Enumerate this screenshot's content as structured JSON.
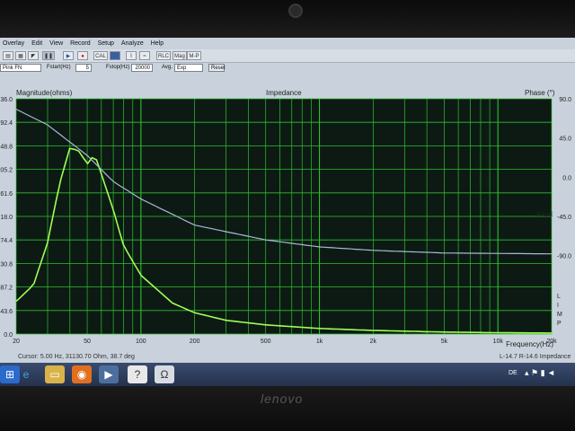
{
  "menu": [
    "Overlay",
    "Edit",
    "View",
    "Record",
    "Setup",
    "Analyze",
    "Help"
  ],
  "toolbar": {
    "buttons": [
      "CAL",
      "RLC",
      "Mag",
      "M-P"
    ]
  },
  "controls": {
    "signal": "Pink FN",
    "fstart_label": "Fstart(Hz)",
    "fstart_value": "5",
    "fstop_label": "Fstop(Hz)",
    "fstop_value": "20000",
    "avg_label": "Avg.",
    "avg_value": "Exp",
    "reset_label": "Reset"
  },
  "plot": {
    "left_axis_title": "Magnitude(ohms)",
    "center_title": "Impedance",
    "right_axis_title": "Phase (°)",
    "avg_label": "Avg.E",
    "limp_label": "LIMP",
    "x_axis_title": "Frequency(Hz)",
    "left_ticks": [
      "36.0",
      "92.4",
      "48.8",
      "05.2",
      "61.6",
      "18.0",
      "74.4",
      "30.8",
      "87.2",
      "43.6",
      "0.0"
    ],
    "right_ticks": [
      "90.0",
      "45.0",
      "0.0",
      "-45.0",
      "-90.0"
    ],
    "x_ticks": [
      "20",
      "50",
      "100",
      "200",
      "500",
      "1k",
      "2k",
      "5k",
      "10k",
      "20k"
    ]
  },
  "status": {
    "cursor_text": "Cursor: 5.00 Hz, 31130.70 Ohm, 38.7 deg",
    "right_text": "L-14.7  R-14.6  Impedance"
  },
  "taskbar": {
    "lang": "DE"
  },
  "bezel": {
    "brand": "lenovo"
  },
  "colors": {
    "plot_bg": "#0d1a14",
    "grid": "#2fbf2f",
    "magnitude": "#9dff55",
    "phase": "#a9b8d6"
  },
  "chart_data": {
    "type": "line",
    "title": "Impedance",
    "xlabel": "Frequency(Hz)",
    "ylabel": "Magnitude(ohms)",
    "y2label": "Phase (°)",
    "x_scale": "log",
    "xlim": [
      20,
      20000
    ],
    "series": [
      {
        "name": "Magnitude",
        "x": [
          20,
          25,
          30,
          35,
          40,
          45,
          50,
          55,
          60,
          70,
          80,
          100,
          150,
          200,
          300,
          500,
          1000,
          2000,
          5000,
          10000,
          20000
        ],
        "y": [
          10,
          15,
          28,
          46,
          57,
          56,
          52,
          55,
          49,
          38,
          27,
          18,
          9.5,
          6.5,
          4.2,
          2.8,
          1.7,
          1.1,
          0.6,
          0.4,
          0.3
        ]
      },
      {
        "name": "Phase",
        "x": [
          20,
          30,
          50,
          70,
          100,
          200,
          500,
          1000,
          2000,
          5000,
          20000
        ],
        "y": [
          78,
          60,
          25,
          -5,
          -25,
          -55,
          -72,
          -80,
          -84,
          -87,
          -88
        ]
      }
    ],
    "ylim": [
      0,
      72
    ],
    "y2lim": [
      -180,
      90
    ]
  }
}
